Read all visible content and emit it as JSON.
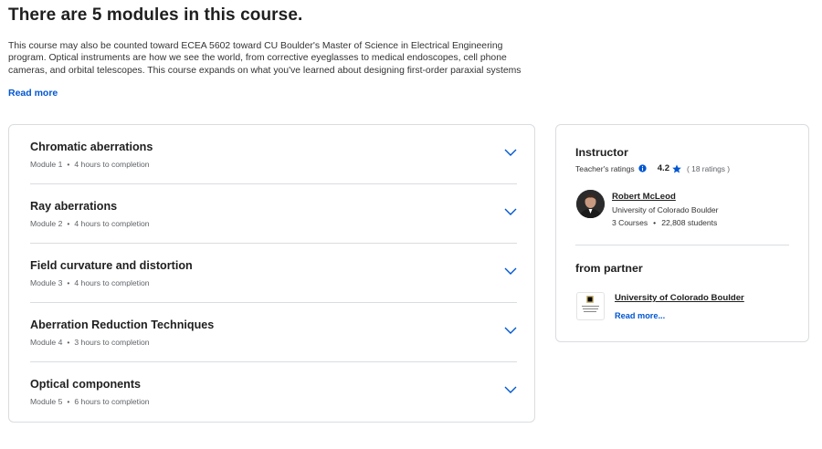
{
  "heading": "There are 5 modules in this course.",
  "description": "This course may also be counted toward ECEA 5602 toward CU Boulder's Master of Science in Electrical Engineering program. Optical instruments are how we see the world, from corrective eyeglasses to medical endoscopes, cell phone cameras, and orbital telescopes. This course expands on what you've learned about designing first-order paraxial systems and optical resolution and efficiency by",
  "read_more": "Read more",
  "modules": [
    {
      "title": "Chromatic aberrations",
      "module": "Module 1",
      "duration": "4 hours to completion"
    },
    {
      "title": "Ray aberrations",
      "module": "Module 2",
      "duration": "4 hours to completion"
    },
    {
      "title": "Field curvature and distortion",
      "module": "Module 3",
      "duration": "4 hours to completion"
    },
    {
      "title": "Aberration Reduction Techniques",
      "module": "Module 4",
      "duration": "3 hours to completion"
    },
    {
      "title": "Optical components",
      "module": "Module 5",
      "duration": "6 hours to completion"
    }
  ],
  "meta_separator": "•",
  "instructor": {
    "section_title": "Instructor",
    "ratings_label": "Teacher's ratings",
    "rating": "4.2",
    "rating_count": "( 18 ratings )",
    "name": "Robert McLeod",
    "organization": "University of Colorado Boulder",
    "courses": "3 Courses",
    "students": "22,808 students"
  },
  "partner": {
    "section_title": "from partner",
    "name": "University of Colorado Boulder",
    "read_more": "Read more...",
    "logo_text": "University of Colorado Boulder"
  },
  "colors": {
    "accent": "#0056d2",
    "border": "#dadce0",
    "star": "#0056d2"
  },
  "icons": {
    "chevron": "chevron-down-icon",
    "info": "info-icon",
    "star": "star-icon"
  }
}
